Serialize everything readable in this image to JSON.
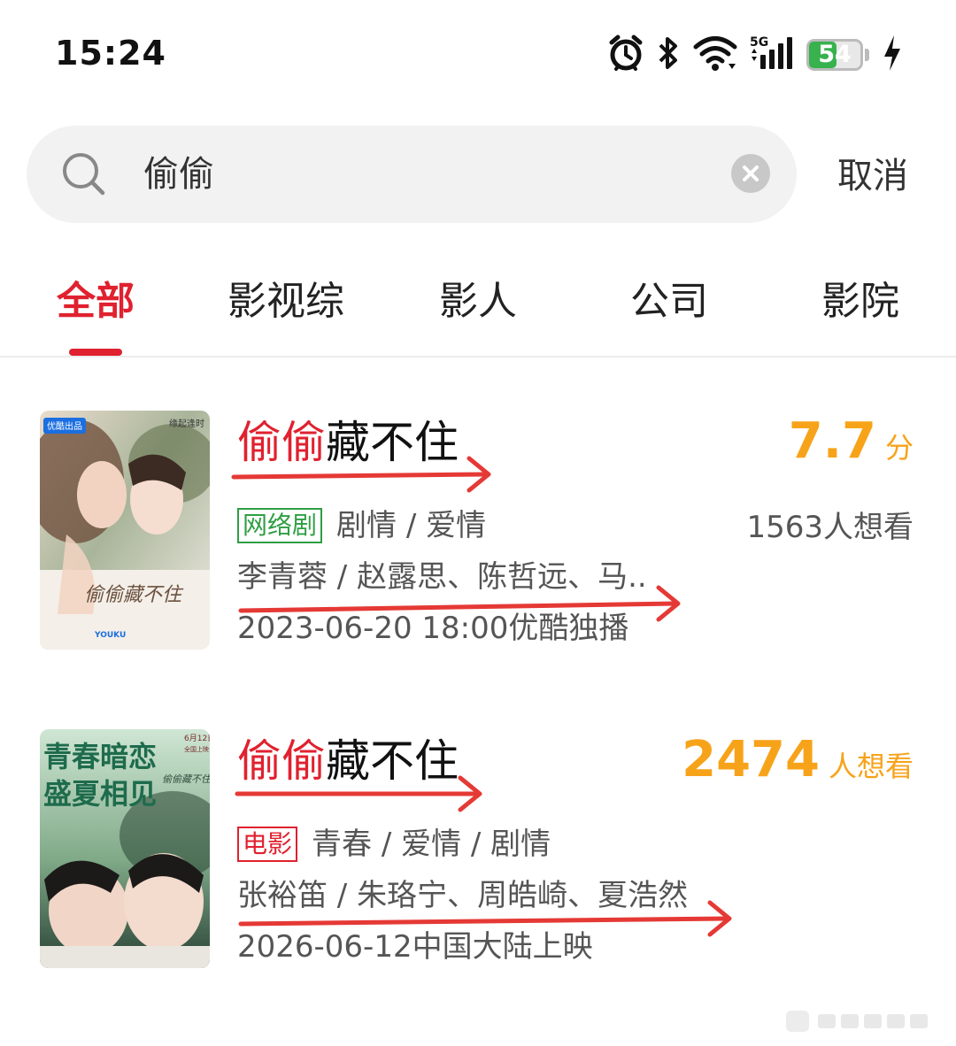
{
  "status_bar": {
    "time": "15:24",
    "network": "5G",
    "battery": "54",
    "battery_level": 0.54,
    "battery_color": "#37b24d"
  },
  "search": {
    "query": "偷偷",
    "cancel_label": "取消"
  },
  "tabs": [
    {
      "label": "全部",
      "active": true
    },
    {
      "label": "影视综",
      "active": false
    },
    {
      "label": "影人",
      "active": false
    },
    {
      "label": "公司",
      "active": false
    },
    {
      "label": "影院",
      "active": false
    }
  ],
  "results": [
    {
      "title_highlight": "偷偷",
      "title_rest": "藏不住",
      "score": "7.7",
      "score_unit": "分",
      "tag": "网络剧",
      "genres": "剧情 / 爱情",
      "want_count": "1563人想看",
      "cast": "李青蓉 / 赵露思、陈哲远、马..",
      "release": "2023-06-20 18:00优酷独播",
      "poster": {
        "badge": "优酷出品",
        "corner": "缘起逢时",
        "script_title": "偷偷藏不住",
        "logos": "YOUKU"
      }
    },
    {
      "title_highlight": "偷偷",
      "title_rest": "藏不住",
      "want_num": "2474",
      "want_unit": "人想看",
      "tag": "电影",
      "genres": "青春 / 爱情 / 剧情",
      "cast": "张裕笛 / 朱珞宁、周皓崎、夏浩然",
      "release": "2026-06-12中国大陆上映",
      "poster": {
        "slogan_1": "青春暗恋",
        "slogan_2": "盛夏相见",
        "date": "6月12日",
        "date_sub": "全国上映",
        "script_title": "偷偷藏不住"
      }
    }
  ],
  "colors": {
    "accent_red": "#e0212f",
    "score_orange": "#f7a31a",
    "tag_green": "#2f9e44",
    "annotation_arrow": "#e53935"
  }
}
